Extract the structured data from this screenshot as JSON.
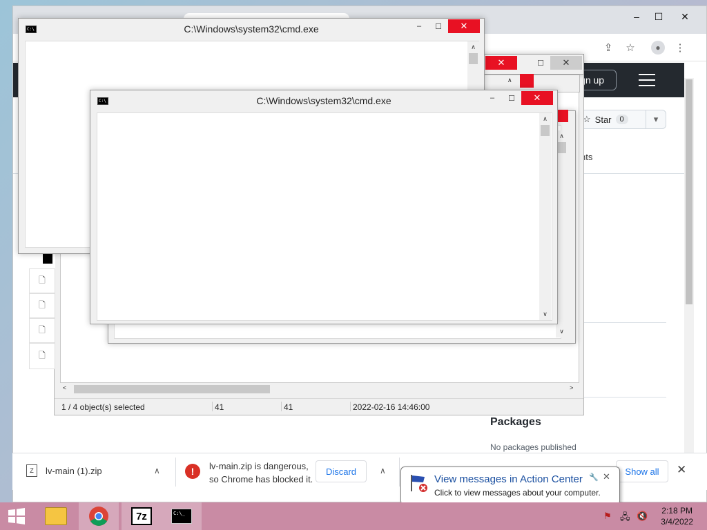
{
  "colors": {
    "close_red": "#e81123",
    "github_dark": "#24292f",
    "link_blue": "#1a73e8",
    "taskbar": "#c98ba4"
  },
  "chrome": {
    "signup_label": "ign up",
    "star_label": "Star",
    "star_count": "0",
    "partial_tab_text": "nts",
    "packages_heading": "Packages",
    "packages_text": "No packages published"
  },
  "cmd_windows": [
    {
      "title": "C:\\Windows\\system32\\cmd.exe"
    },
    {
      "title": "C:\\Windows\\system32\\cmd.exe"
    }
  ],
  "explorer": {
    "status": {
      "selection": "1 / 4 object(s) selected",
      "size": "41",
      "packed": "41",
      "modified": "2022-02-16 14:46:00"
    }
  },
  "downloads": {
    "file1_name": "lv-main (1).zip",
    "warning_line1": "lv-main.zip is dangerous,",
    "warning_line2": "so Chrome has blocked it.",
    "discard_label": "Discard",
    "show_all_label": "Show all"
  },
  "balloon": {
    "title": "View messages in Action Center",
    "body": "Click to view messages about your computer."
  },
  "taskbar": {
    "time": "2:18 PM",
    "date": "3/4/2022",
    "apps": [
      "file-explorer-icon",
      "chrome-icon",
      "7zip-icon",
      "cmd-icon"
    ],
    "sevenzip_label": "7z"
  }
}
